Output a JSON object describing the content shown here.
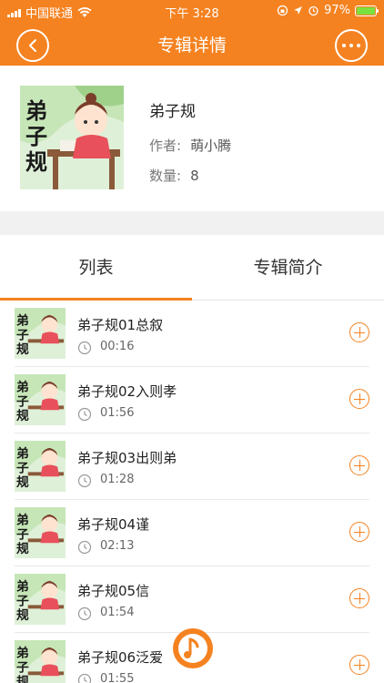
{
  "status_bar": {
    "carrier": "中国联通",
    "time": "下午 3:28",
    "battery": "97%"
  },
  "nav": {
    "title": "专辑详情",
    "back_icon": "chevron-left-icon",
    "more_icon": "more-dots-icon"
  },
  "album": {
    "title": "弟子规",
    "author_label": "作者:",
    "author": "萌小腾",
    "count_label": "数量:",
    "count": "8",
    "cover_text": "弟子规"
  },
  "tabs": [
    {
      "label": "列表",
      "active": true
    },
    {
      "label": "专辑简介",
      "active": false
    }
  ],
  "tracks": [
    {
      "title": "弟子规01总叙",
      "duration": "00:16"
    },
    {
      "title": "弟子规02入则孝",
      "duration": "01:56"
    },
    {
      "title": "弟子规03出则弟",
      "duration": "01:28"
    },
    {
      "title": "弟子规04谨",
      "duration": "02:13"
    },
    {
      "title": "弟子规05信",
      "duration": "01:54"
    },
    {
      "title": "弟子规06泛爱",
      "duration": "01:55"
    }
  ],
  "colors": {
    "accent": "#f58220",
    "battery_fill": "#7ce03f",
    "background_gap": "#f1f1f1"
  }
}
